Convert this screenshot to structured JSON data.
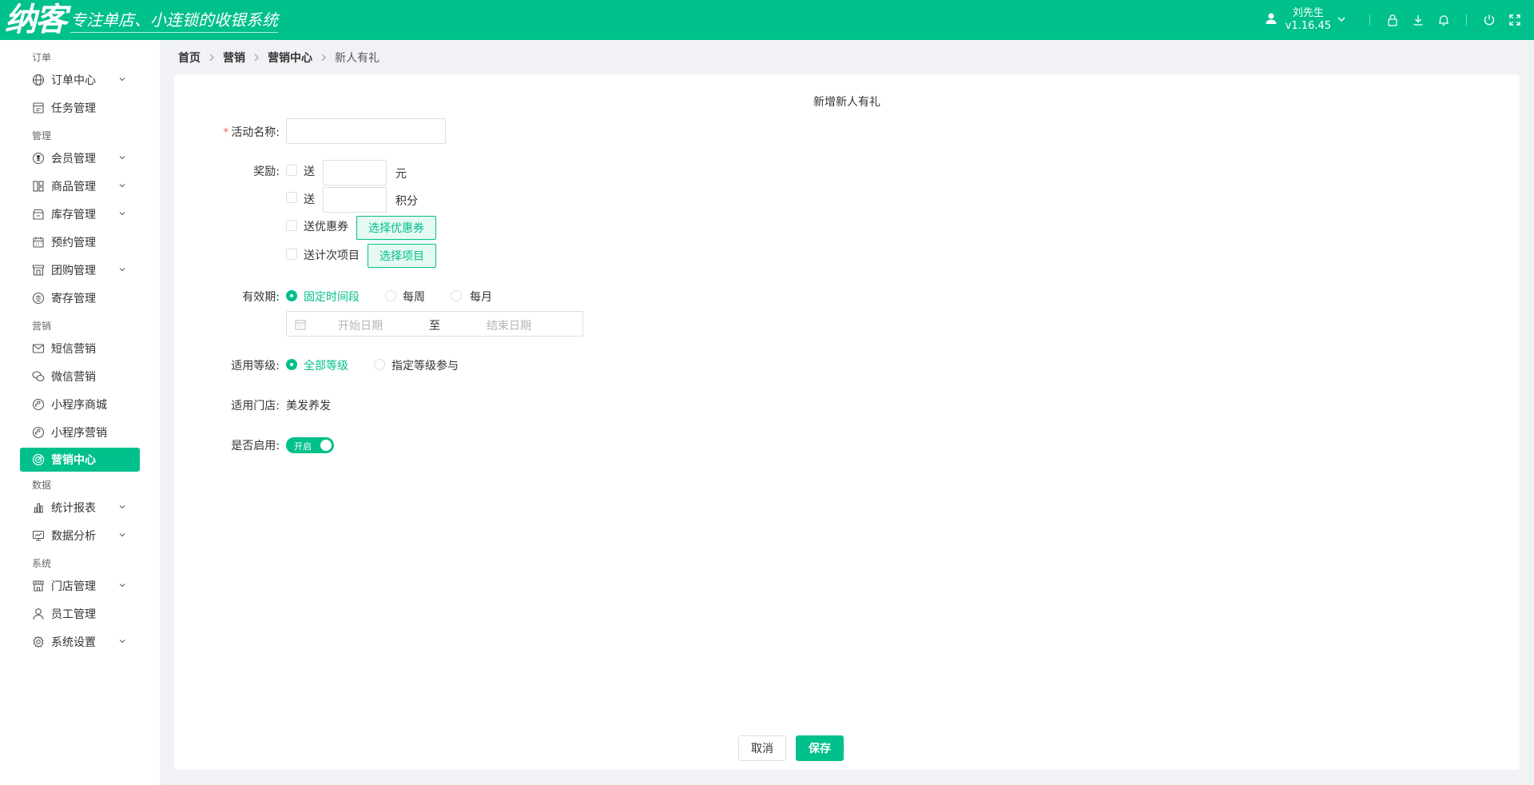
{
  "brand": {
    "logo_text": "纳客",
    "slogan": "专注单店、小连锁的收银系统"
  },
  "user": {
    "name": "刘先生",
    "version": "v1.16.45"
  },
  "sidebar": {
    "groups": [
      {
        "title": "订单",
        "items": [
          {
            "label": "订单中心",
            "icon": "globe-icon",
            "expandable": true
          },
          {
            "label": "任务管理",
            "icon": "task-icon",
            "expandable": false
          }
        ]
      },
      {
        "title": "管理",
        "items": [
          {
            "label": "会员管理",
            "icon": "yen-icon",
            "expandable": true
          },
          {
            "label": "商品管理",
            "icon": "grid-icon",
            "expandable": true
          },
          {
            "label": "库存管理",
            "icon": "store-icon",
            "expandable": true
          },
          {
            "label": "预约管理",
            "icon": "calendar-icon",
            "expandable": false
          },
          {
            "label": "团购管理",
            "icon": "shop-icon",
            "expandable": true
          },
          {
            "label": "寄存管理",
            "icon": "deposit-icon",
            "expandable": false
          }
        ]
      },
      {
        "title": "营销",
        "items": [
          {
            "label": "短信营销",
            "icon": "mail-icon",
            "expandable": false
          },
          {
            "label": "微信营销",
            "icon": "wechat-icon",
            "expandable": false
          },
          {
            "label": "小程序商城",
            "icon": "miniapp-icon",
            "expandable": false
          },
          {
            "label": "小程序营销",
            "icon": "miniapp-icon",
            "expandable": false
          },
          {
            "label": "营销中心",
            "icon": "target-icon",
            "expandable": false,
            "active": true
          }
        ]
      },
      {
        "title": "数据",
        "items": [
          {
            "label": "统计报表",
            "icon": "bar-chart-icon",
            "expandable": true
          },
          {
            "label": "数据分析",
            "icon": "monitor-icon",
            "expandable": true
          }
        ]
      },
      {
        "title": "系统",
        "items": [
          {
            "label": "门店管理",
            "icon": "store-front-icon",
            "expandable": true
          },
          {
            "label": "员工管理",
            "icon": "person-icon",
            "expandable": false
          },
          {
            "label": "系统设置",
            "icon": "gear-icon",
            "expandable": true
          }
        ]
      }
    ]
  },
  "breadcrumb": [
    "首页",
    "营销",
    "营销中心",
    "新人有礼"
  ],
  "form": {
    "title": "新增新人有礼",
    "name_label": "活动名称:",
    "name_value": "",
    "reward_label": "奖励:",
    "reward_money_prefix": "送",
    "reward_money_unit": "元",
    "reward_points_prefix": "送",
    "reward_points_unit": "积分",
    "reward_coupon_label": "送优惠券",
    "reward_coupon_button": "选择优惠券",
    "reward_count_label": "送计次项目",
    "reward_count_button": "选择项目",
    "validity_label": "有效期:",
    "validity_options": [
      "固定时间段",
      "每周",
      "每月"
    ],
    "validity_selected": "固定时间段",
    "start_placeholder": "开始日期",
    "range_sep": "至",
    "end_placeholder": "结束日期",
    "level_label": "适用等级:",
    "level_options": [
      "全部等级",
      "指定等级参与"
    ],
    "level_selected": "全部等级",
    "store_label": "适用门店:",
    "store_value": "美发养发",
    "enable_label": "是否启用:",
    "enable_text": "开启",
    "enabled": true
  },
  "footer": {
    "cancel": "取消",
    "save": "保存"
  },
  "colors": {
    "accent": "#00c08b",
    "required": "#f56c6c"
  }
}
